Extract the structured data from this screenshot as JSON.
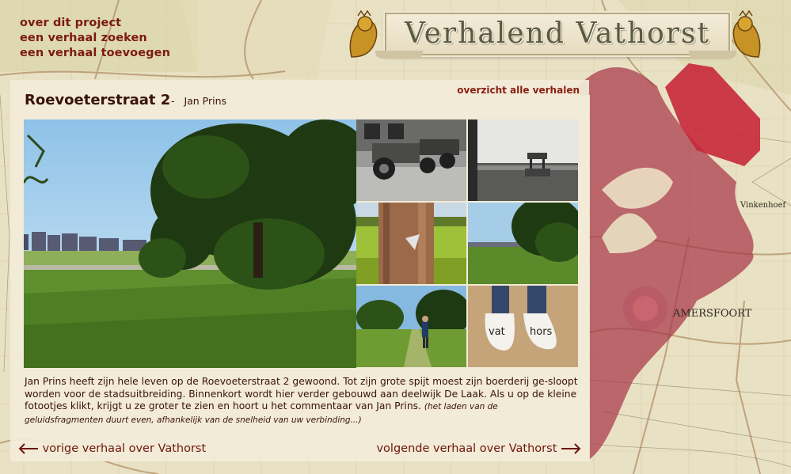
{
  "nav": {
    "items": [
      {
        "label": "over dit project"
      },
      {
        "label": "een verhaal zoeken"
      },
      {
        "label": "een verhaal toevoegen"
      }
    ]
  },
  "logo": {
    "text": "Verhalend Vathorst"
  },
  "story": {
    "title": "Roevoeterstraat 2",
    "author_sep": "-",
    "author": "Jan Prins",
    "overview_link": "overzicht alle verhalen",
    "description": "Jan Prins heeft zijn hele leven op de Roevoeterstraat 2 gewoond. Tot zijn grote spijt moest zijn boerderij ge-sloopt worden voor de stadsuitbreiding. Binnenkort wordt hier verder gebouwd aan deelwijk De Laak. Als u op de kleine fotootjes klikt, krijgt u ze groter te zien en hoort u het commentaar van Jan Prins.",
    "note": "(het laden van de geluidsfragmenten duurt even, afhankelijk van de snelheid van uw verbinding...)"
  },
  "footer": {
    "prev_label": "vorige verhaal over Vathorst",
    "next_label": "volgende verhaal over Vathorst"
  },
  "map": {
    "city_label": "AMERSFOORT",
    "village_label": "Vinkenhoef"
  },
  "colors": {
    "accent": "#7a1a10",
    "panel": "#f2ecd8",
    "highlight_red": "#c8283a",
    "region": "#a8364a"
  },
  "thumbs": [
    {
      "icon": "tractor-photo"
    },
    {
      "icon": "well-photo"
    },
    {
      "icon": "tree-trunk-photo"
    },
    {
      "icon": "field-tree-photo"
    },
    {
      "icon": "man-path-photo"
    },
    {
      "icon": "wooden-shoes-photo"
    }
  ]
}
